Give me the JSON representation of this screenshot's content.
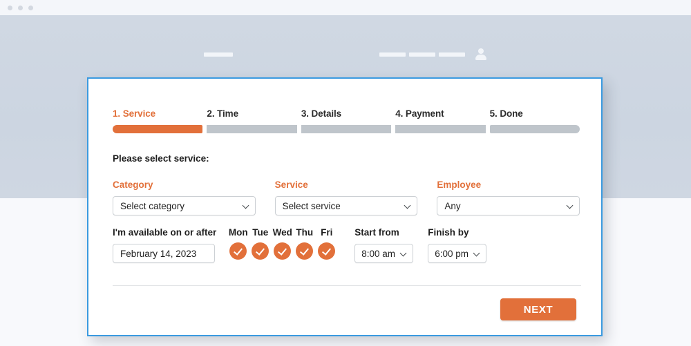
{
  "browser": {
    "window_dots": [
      "close",
      "minimize",
      "maximize"
    ]
  },
  "site": {
    "logo_placeholder": "",
    "nav_placeholders": [
      "",
      "",
      ""
    ],
    "account_icon": "person-icon"
  },
  "colors": {
    "accent_orange": "#E2703A",
    "modal_border_blue": "#3A9AE0",
    "progress_inactive": "#BFC5CB",
    "header_gray": "#CCD5E1",
    "page_background": "#F8F9FC"
  },
  "modal": {
    "steps": [
      {
        "label": "1. Service",
        "active": true
      },
      {
        "label": "2. Time",
        "active": false
      },
      {
        "label": "3. Details",
        "active": false
      },
      {
        "label": "4. Payment",
        "active": false
      },
      {
        "label": "5. Done",
        "active": false
      }
    ],
    "section_title": "Please select service:",
    "fields": [
      {
        "label": "Category",
        "value": "Select category"
      },
      {
        "label": "Service",
        "value": "Select service"
      },
      {
        "label": "Employee",
        "value": "Any"
      }
    ],
    "availability": {
      "date_label": "I'm available on or after",
      "date_value": "February 14, 2023",
      "days": [
        {
          "name": "Mon",
          "checked": true
        },
        {
          "name": "Tue",
          "checked": true
        },
        {
          "name": "Wed",
          "checked": true
        },
        {
          "name": "Thu",
          "checked": true
        },
        {
          "name": "Fri",
          "checked": true
        }
      ],
      "start_label": "Start from",
      "start_value": "8:00 am",
      "finish_label": "Finish by",
      "finish_value": "6:00 pm"
    },
    "next_label": "NEXT"
  }
}
